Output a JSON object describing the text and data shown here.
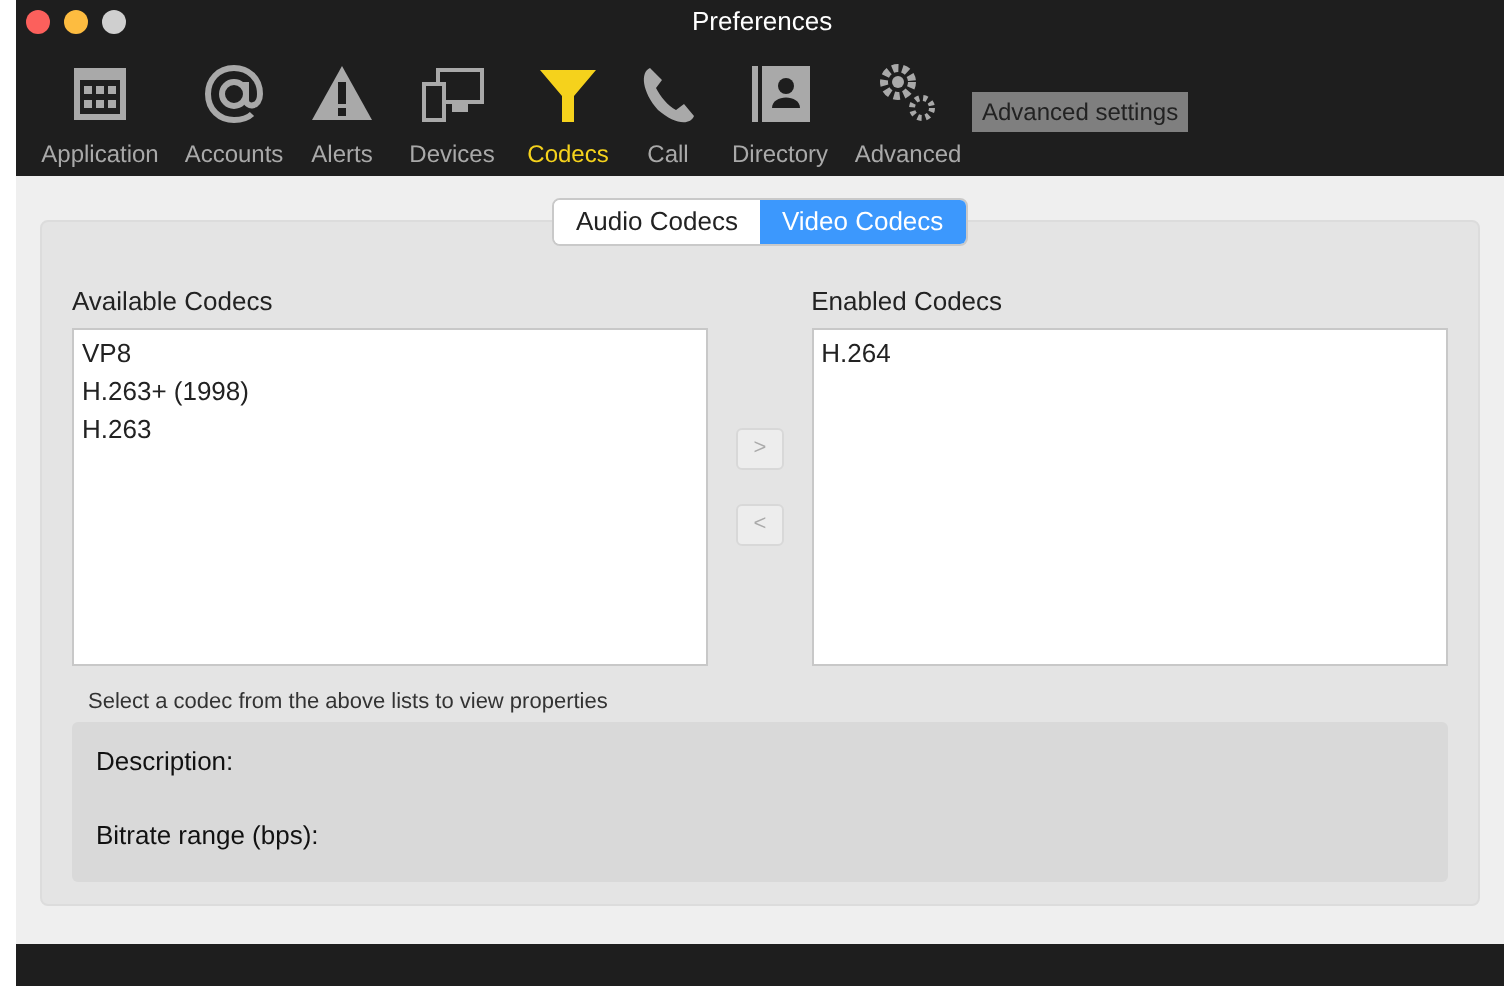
{
  "window": {
    "title": "Preferences"
  },
  "toolbar": [
    {
      "label": "Application",
      "kind": "calendar",
      "selected": false
    },
    {
      "label": "Accounts",
      "kind": "at",
      "selected": false
    },
    {
      "label": "Alerts",
      "kind": "warning",
      "selected": false
    },
    {
      "label": "Devices",
      "kind": "devices",
      "selected": false
    },
    {
      "label": "Codecs",
      "kind": "funnel",
      "selected": true
    },
    {
      "label": "Call",
      "kind": "phone",
      "selected": false
    },
    {
      "label": "Directory",
      "kind": "contact",
      "selected": false
    },
    {
      "label": "Advanced",
      "kind": "gears",
      "selected": false
    }
  ],
  "tooltip": "Advanced settings",
  "tabs": [
    {
      "label": "Audio Codecs",
      "selected": false
    },
    {
      "label": "Video Codecs",
      "selected": true
    }
  ],
  "available": {
    "title": "Available Codecs",
    "items": [
      "VP8",
      "H.263+ (1998)",
      "H.263"
    ]
  },
  "move_buttons": [
    ">",
    "<"
  ],
  "enabled": {
    "title": "Enabled Codecs",
    "items": [
      "H.264"
    ]
  },
  "hint": "Select a codec from the above lists to view properties",
  "properties": [
    "Description:",
    "Bitrate range (bps):"
  ]
}
